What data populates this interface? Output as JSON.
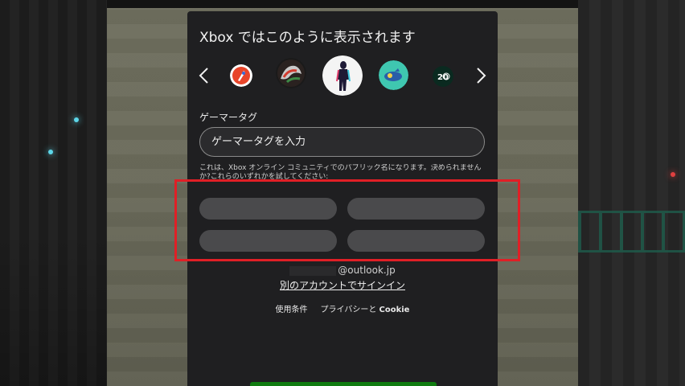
{
  "dialog": {
    "title": "Xbox ではこのように表示されます",
    "gamertag_label": "ゲーマータグ",
    "gamertag_placeholder": "ゲーマータグを入力",
    "helper_text": "これは、Xbox オンライン コミュニティでのパブリック名になります。決められませんか?これらのいずれかを試してください:",
    "account_suffix": "@outlook.jp",
    "switch_account": "別のアカウントでサインイン",
    "footer": {
      "terms": "使用条件",
      "privacy": "プライバシーと",
      "cookie": "Cookie"
    }
  },
  "avatars": [
    {
      "name": "rocket-avatar"
    },
    {
      "name": "dragon-avatar"
    },
    {
      "name": "silhouette-avatar",
      "selected": true
    },
    {
      "name": "teal-submarine-avatar"
    },
    {
      "name": "xbox-20-avatar"
    }
  ],
  "suggestions": [
    "",
    "",
    "",
    ""
  ],
  "colors": {
    "dialog_bg": "#1f1f21",
    "highlight": "#e01f26",
    "suggestion_bg": "#4a4a4c",
    "xbox_green": "#107c10"
  }
}
